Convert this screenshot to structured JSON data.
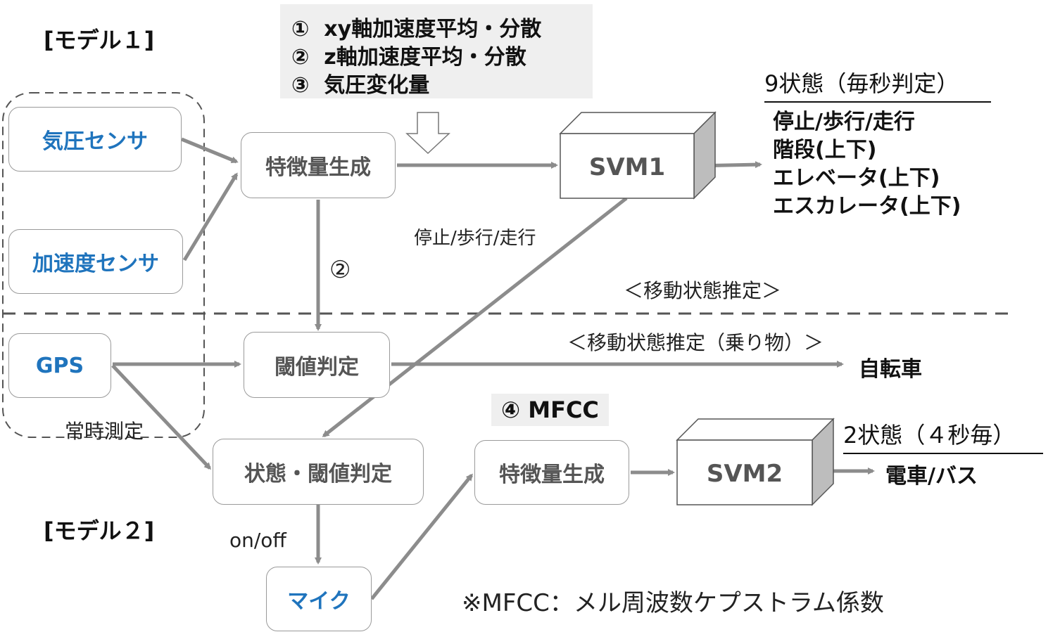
{
  "model1_label": "[モデル１]",
  "model2_label": "[モデル２]",
  "features": {
    "items": [
      {
        "num": "①",
        "text": "xy軸加速度平均・分散"
      },
      {
        "num": "②",
        "text": "z軸加速度平均・分散"
      },
      {
        "num": "③",
        "text": "気圧変化量"
      }
    ]
  },
  "boxes": {
    "pressure_sensor": "気圧センサ",
    "accel_sensor": "加速度センサ",
    "gps": "GPS",
    "feature_gen_1": "特徴量生成",
    "svm1": "SVM1",
    "threshold": "閾値判定",
    "state_threshold": "状態・閾値判定",
    "feature_gen_2": "特徴量生成",
    "svm2": "SVM2",
    "mic": "マイク"
  },
  "labels": {
    "always_measure": "常時測定",
    "stop_walk_run": "停止/歩行/走行",
    "circle_two": "②",
    "movement_estimation": "＜移動状態推定＞",
    "vehicle_estimation": "＜移動状態推定（乗り物）＞",
    "bicycle": "自転車",
    "mfcc_tag": "④ MFCC",
    "on_off": "on/off",
    "mfcc_note": "※MFCC：メル周波数ケプストラム係数"
  },
  "svm1_output": {
    "title": "9状態（毎秒判定）",
    "items": [
      "停止/歩行/走行",
      "階段(上下)",
      "エレベータ(上下)",
      "エスカレータ(上下)"
    ]
  },
  "svm2_output": {
    "title": "2状態（４秒毎）",
    "result": "電車/バス"
  },
  "colors": {
    "sensor_blue": "#1f74bd",
    "arrow_gray": "#8c8c8c",
    "panel_gray": "#efefef"
  }
}
